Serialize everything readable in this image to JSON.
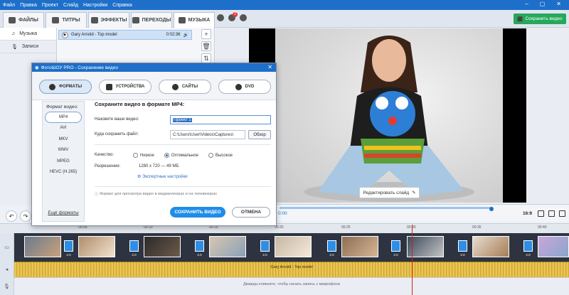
{
  "menu": [
    "Файл",
    "Правка",
    "Проект",
    "Слайд",
    "Настройки",
    "Справка"
  ],
  "tabs": [
    {
      "label": "ФАЙЛЫ"
    },
    {
      "label": "ТИТРЫ"
    },
    {
      "label": "ЭФФЕКТЫ"
    },
    {
      "label": "ПЕРЕХОДЫ"
    },
    {
      "label": "МУЗЫКА"
    }
  ],
  "notification_count": "2",
  "save_video_top": "Сохранить видео",
  "library": {
    "categories": [
      "Музыка",
      "Записи"
    ],
    "track": {
      "title": "Gary Arnold - Top model",
      "duration": "0:02:36"
    }
  },
  "preview": {
    "edit_slide": "Редактировать слайд",
    "timecode": "0:00",
    "ratio": "16:9"
  },
  "timeline": {
    "ticks": [
      "00:05",
      "00:10",
      "00:15",
      "00:20",
      "00:25",
      "00:30",
      "00:35",
      "00:40"
    ],
    "audio_label": "Gary Arnold - Top model",
    "mic_hint": "Дважды кликните, чтобы начать запись с микрофона",
    "transitions": [
      "2.0",
      "2.0",
      "2.0",
      "2.0",
      "2.0",
      "2.0",
      "2.0",
      "2.0"
    ]
  },
  "dialog": {
    "title": "ФотоШОУ PRO - Сохранение видео",
    "tabs": [
      "ФОРМАТЫ",
      "УСТРОЙСТВА",
      "САЙТЫ",
      "DVD"
    ],
    "format_heading": "Формат видео:",
    "formats": [
      "MP4",
      "AVI",
      "MKV",
      "WMV",
      "MPEG",
      "HEVC (H.265)"
    ],
    "more_formats": "Ещё форматы",
    "heading": "Сохраните видео в формате MP4:",
    "name_label": "Назовите ваше видео:",
    "name_value": "Проект 1",
    "path_label": "Куда сохранить файл:",
    "path_value": "C:\\Users\\User\\Videos\\Captures\\",
    "browse": "Обзор",
    "quality_label": "Качество:",
    "quality_options": [
      "Низкое",
      "Оптимальное",
      "Высокое"
    ],
    "quality_selected": "Оптимальное",
    "resolution_label": "Разрешение:",
    "resolution_value": "1280 x 720  —  49 МБ",
    "expert": "Экспертные настройки",
    "hint": "Формат для просмотра видео в медиаплеерах и на телевизорах",
    "save_button": "СОХРАНИТЬ ВИДЕО",
    "cancel_button": "ОТМЕНА"
  },
  "colors": {
    "accent": "#1d6fc9",
    "save_green": "#25a85a",
    "audio": "#e2bc45",
    "playhead": "#d31f1f"
  }
}
